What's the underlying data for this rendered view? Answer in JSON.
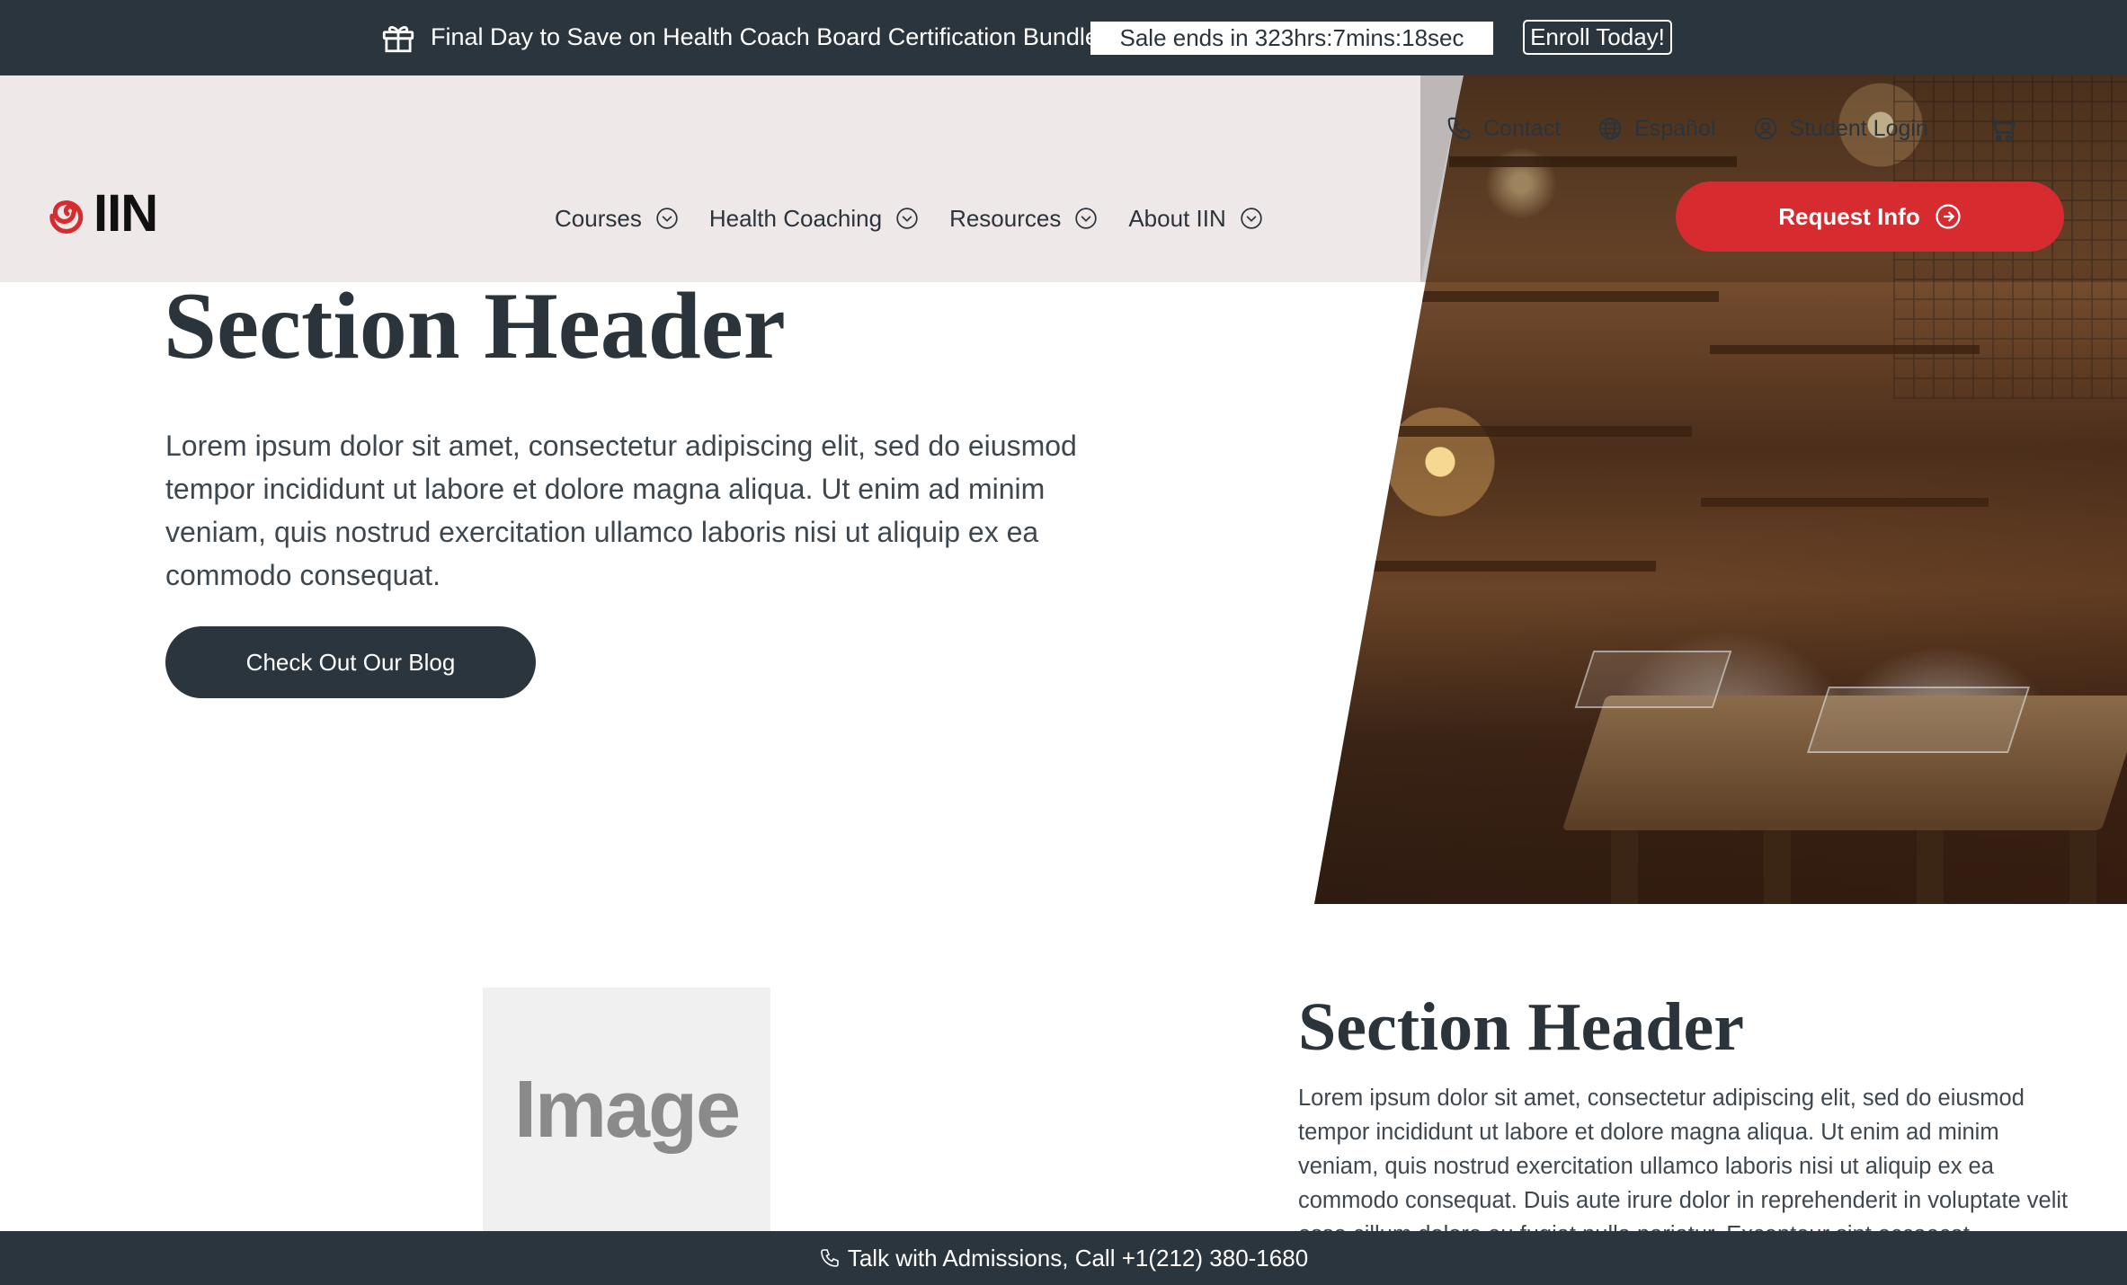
{
  "promo": {
    "text": "Final Day to Save on Health Coach Board Certification Bundle",
    "timer": "Sale ends in 323hrs:7mins:18sec",
    "cta": "Enroll Today!",
    "icon": "gift-icon"
  },
  "header": {
    "logo_text": "IIN",
    "nav": [
      {
        "label": "Courses"
      },
      {
        "label": "Health Coaching"
      },
      {
        "label": "Resources"
      },
      {
        "label": "About IIN"
      }
    ],
    "utility": {
      "contact": "Contact",
      "language": "Español",
      "student": "Student Login"
    },
    "request_info": "Request Info"
  },
  "hero": {
    "heading": "Section Header",
    "body": "Lorem ipsum dolor sit amet, consectetur adipiscing elit, sed do eiusmod tempor incididunt ut labore et dolore magna aliqua. Ut enim ad minim veniam, quis nostrud exercitation ullamco laboris nisi ut aliquip ex ea commodo consequat.",
    "button": "Check Out Our Blog"
  },
  "section2": {
    "image_label": "Image",
    "heading": "Section Header",
    "body": "Lorem ipsum dolor sit amet, consectetur adipiscing elit, sed do eiusmod tempor incididunt ut labore et dolore magna aliqua. Ut enim ad minim veniam, quis nostrud exercitation ullamco laboris nisi ut aliquip ex ea commodo consequat. Duis aute irure dolor in reprehenderit in voluptate velit esse cillum dolore eu fugiat nulla pariatur. Excepteur sint occaecat"
  },
  "footer": {
    "text": "Talk with Admissions, Call +1(212) 380-1680"
  },
  "colors": {
    "brand_red": "#d62b2f",
    "dark": "#2b353e",
    "header_bg": "#eee8e8"
  }
}
